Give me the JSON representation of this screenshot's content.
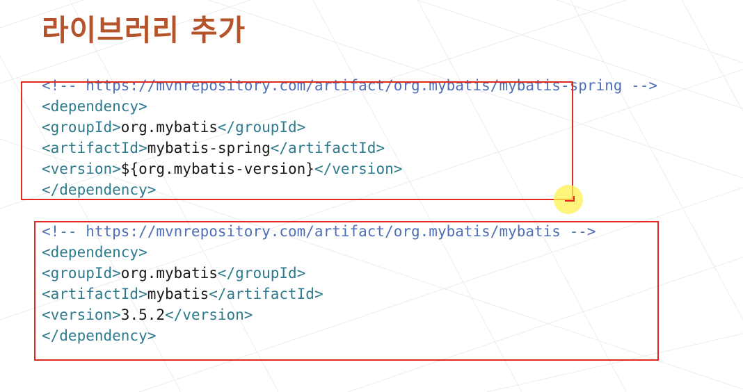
{
  "slide": {
    "title": "라이브러리 추가"
  },
  "blocks": [
    {
      "comment": "<!-- https://mvnrepository.com/artifact/org.mybatis/mybatis-spring -->",
      "dependency_open": "<dependency>",
      "group_open": "<groupId>",
      "group_value": "org.mybatis",
      "group_close": "</groupId>",
      "artifact_open": "<artifactId>",
      "artifact_value": "mybatis-spring",
      "artifact_close": "</artifactId>",
      "version_open": "<version>",
      "version_value": "${org.mybatis-version}",
      "version_close": "</version>",
      "dependency_close": "</dependency>"
    },
    {
      "comment": "<!-- https://mvnrepository.com/artifact/org.mybatis/mybatis -->",
      "dependency_open": "<dependency>",
      "group_open": "<groupId>",
      "group_value": "org.mybatis",
      "group_close": "</groupId>",
      "artifact_open": "<artifactId>",
      "artifact_value": "mybatis",
      "artifact_close": "</artifactId>",
      "version_open": "<version>",
      "version_value": "3.5.2",
      "version_close": "</version>",
      "dependency_close": "</dependency>"
    }
  ],
  "colors": {
    "title": "#b5532a",
    "highlight_box": "#e0281e",
    "comment": "#4e6fb5",
    "tag": "#2c7a8c"
  }
}
